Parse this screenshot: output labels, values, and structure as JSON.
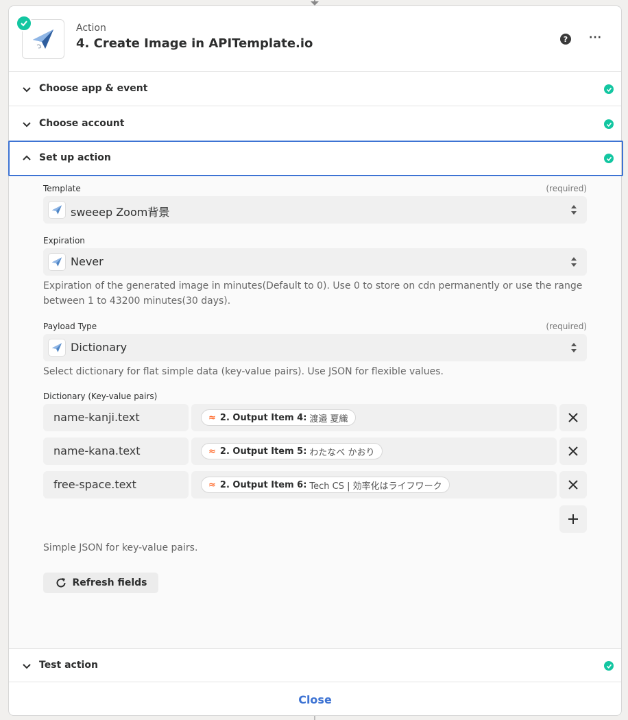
{
  "header": {
    "kicker": "Action",
    "title": "4. Create Image in APITemplate.io",
    "help": "?",
    "more": "···"
  },
  "sections": {
    "choose_app": "Choose app & event",
    "choose_account": "Choose account",
    "setup_action": "Set up action",
    "test_action": "Test action"
  },
  "form": {
    "template": {
      "label": "Template",
      "required": "(required)",
      "value": "sweeep Zoom背景"
    },
    "expiration": {
      "label": "Expiration",
      "value": "Never",
      "help": "Expiration of the generated image in minutes(Default to 0). Use 0 to store on cdn permanently or use the range between 1 to 43200 minutes(30 days)."
    },
    "payload_type": {
      "label": "Payload Type",
      "required": "(required)",
      "value": "Dictionary",
      "help": "Select dictionary for flat simple data (key-value pairs). Use JSON for flexible values."
    },
    "dictionary": {
      "label": "Dictionary (Key-value pairs)",
      "rows": [
        {
          "key": "name-kanji.text",
          "pill_label": "2. Output Item 4:",
          "pill_value": "渡邉 夏織"
        },
        {
          "key": "name-kana.text",
          "pill_label": "2. Output Item 5:",
          "pill_value": "わたなべ かおり"
        },
        {
          "key": "free-space.text",
          "pill_label": "2. Output Item 6:",
          "pill_value": "Tech CS | 効率化はライフワーク"
        }
      ],
      "help": "Simple JSON for key-value pairs."
    },
    "refresh_label": "Refresh fields"
  },
  "footer": {
    "close_label": "Close"
  },
  "colors": {
    "accent": "#3d73d3",
    "success": "#13c6a1",
    "token": "#ff6a2b"
  },
  "icons": [
    "check-icon",
    "paper-plane-icon",
    "help-icon",
    "more-icon",
    "chevron-down-icon",
    "chevron-up-icon",
    "updown-icon",
    "close-icon",
    "plus-icon",
    "refresh-icon"
  ]
}
